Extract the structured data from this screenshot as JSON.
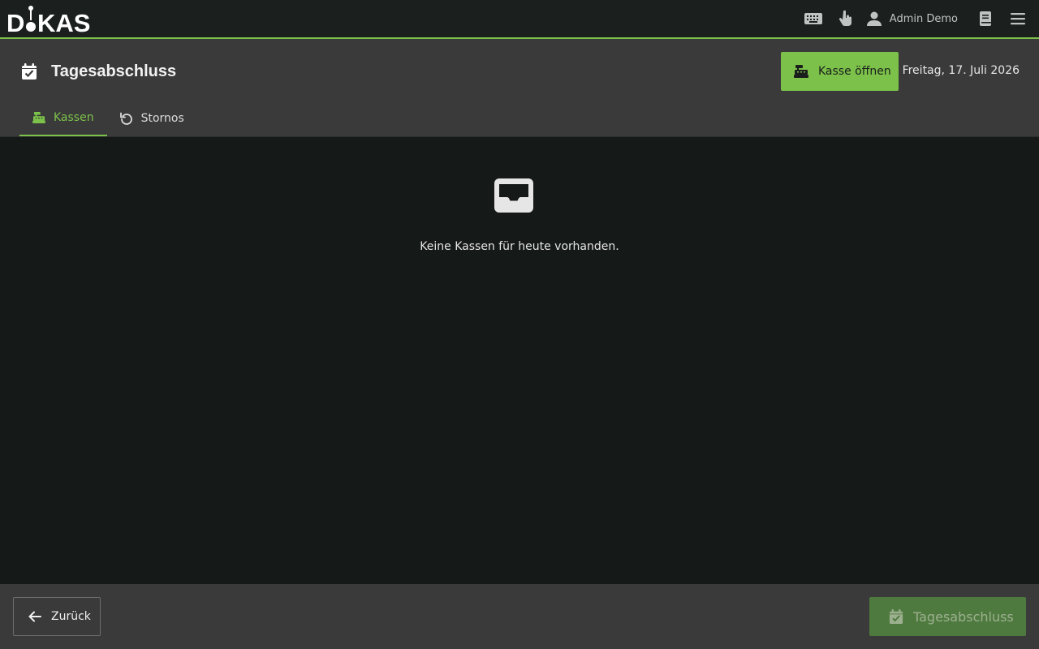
{
  "app": {
    "logo_text": "DiKAS",
    "user_name": "Admin Demo"
  },
  "topbar": {
    "icons": [
      "keyboard-icon",
      "touch-icon",
      "user-icon",
      "book-icon",
      "menu-icon"
    ]
  },
  "header": {
    "title": "Tagesabschluss",
    "open_register_label": "Kasse öffnen",
    "date": "Freitag, 17. Juli 2026"
  },
  "tabs": [
    {
      "label": "Kassen",
      "icon": "cash-register-icon",
      "active": true
    },
    {
      "label": "Stornos",
      "icon": "undo-icon",
      "active": false
    }
  ],
  "content": {
    "empty_message": "Keine Kassen für heute vorhanden."
  },
  "footer": {
    "back_label": "Zurück",
    "close_day_label": "Tagesabschluss"
  },
  "colors": {
    "accent": "#7cc24a",
    "topbar": "#1b201e",
    "header": "#3a3a3a",
    "content": "#151917",
    "disabled_button": "#4f7a3f"
  }
}
